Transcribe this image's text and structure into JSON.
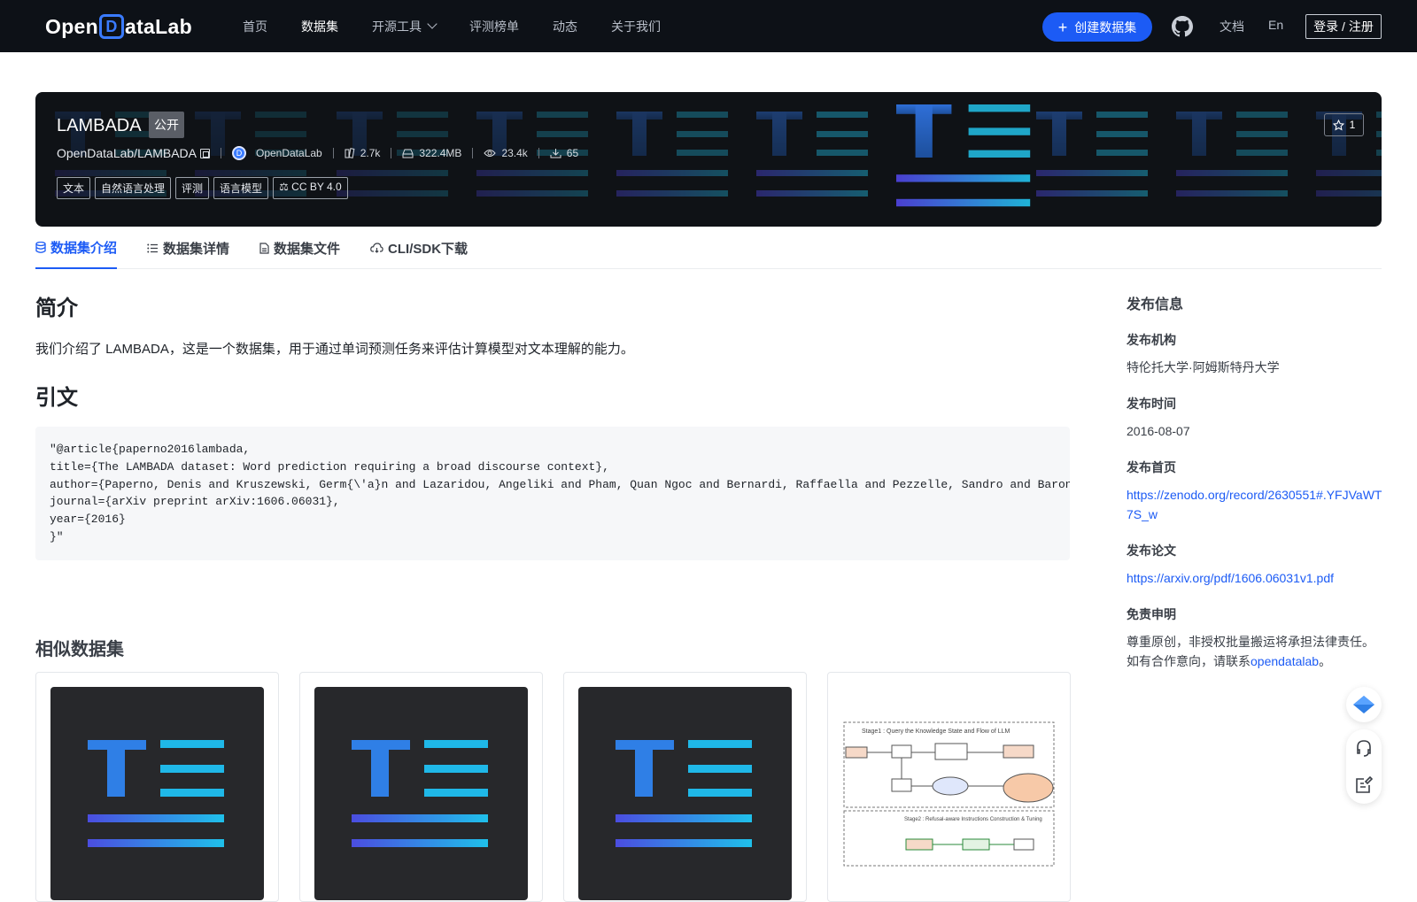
{
  "nav": {
    "logo_text_a": "Open",
    "logo_text_d": "D",
    "logo_text_b": "ataLab",
    "items": [
      {
        "label": "首页"
      },
      {
        "label": "数据集"
      },
      {
        "label": "开源工具"
      },
      {
        "label": "评测榜单"
      },
      {
        "label": "动态"
      },
      {
        "label": "关于我们"
      }
    ],
    "create_label": "创建数据集",
    "docs_label": "文档",
    "lang_label": "En",
    "login_label": "登录 / 注册"
  },
  "dataset": {
    "title": "LAMBADA",
    "visibility": "公开",
    "path": "OpenDataLab/LAMBADA",
    "org": "OpenDataLab",
    "files": "2.7k",
    "size": "322.4MB",
    "views": "23.4k",
    "downloads": "65",
    "stars": "1",
    "tags": [
      "文本",
      "自然语言处理",
      "评测",
      "语言模型"
    ],
    "license": "CC BY 4.0"
  },
  "tabs": [
    {
      "label": "数据集介绍"
    },
    {
      "label": "数据集详情"
    },
    {
      "label": "数据集文件"
    },
    {
      "label": "CLI/SDK下载"
    }
  ],
  "content": {
    "intro_heading": "简介",
    "intro_text": "我们介绍了 LAMBADA，这是一个数据集，用于通过单词预测任务来评估计算模型对文本理解的能力。",
    "citation_heading": "引文",
    "citation_lines": [
      "\"@article{paperno2016lambada,",
      "title={The LAMBADA dataset: Word prediction requiring a broad discourse context},",
      "author={Paperno, Denis and Kruszewski, Germ{\\'a}n and Lazaridou, Angeliki and Pham, Quan Ngoc and Bernardi, Raffaella and Pezzelle, Sandro and Baroni, Marco and Boleda, Gemma and Fern{\\'a}ndez, Raquel},",
      "journal={arXiv preprint arXiv:1606.06031},",
      "year={2016}",
      "}\""
    ],
    "similar_heading": "相似数据集"
  },
  "sidebar": {
    "title": "发布信息",
    "org_label": "发布机构",
    "org_value": "特伦托大学·阿姆斯特丹大学",
    "time_label": "发布时间",
    "time_value": "2016-08-07",
    "home_label": "发布首页",
    "home_url": "https://zenodo.org/record/2630551#.YFJVaWT7S_w",
    "paper_label": "发布论文",
    "paper_url": "https://arxiv.org/pdf/1606.06031v1.pdf",
    "disclaimer_label": "免责申明",
    "disclaimer_text": "尊重原创，非授权批量搬运将承担法律责任。如有合作意向，请联系",
    "disclaimer_link": "opendatalab",
    "disclaimer_end": "。"
  },
  "paper_thumb": {
    "stage1": "Stage1 : Query the Knowledge State and Flow of LLM",
    "stage2": "Stage2 : Refusal-aware Instructions Construction & Tuning"
  },
  "colors": {
    "nav_bg": "#0d1117",
    "accent": "#1c5bf5"
  }
}
